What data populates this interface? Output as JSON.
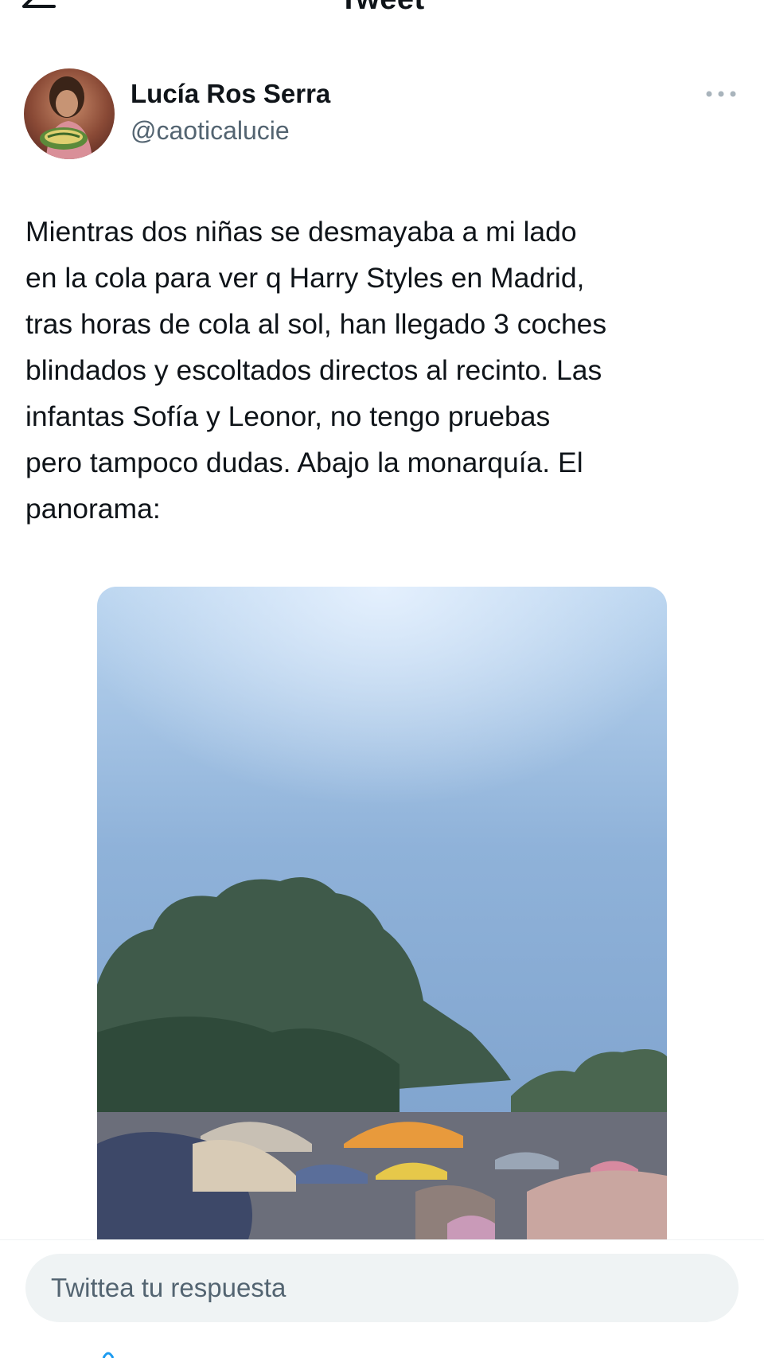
{
  "header": {
    "title": "Tweet",
    "back_icon": "arrow-left-icon"
  },
  "author": {
    "display_name": "Lucía Ros Serra",
    "handle": "@caoticalucie",
    "more_icon": "more-horizontal-icon"
  },
  "tweet": {
    "text": "Mientras dos niñas se desmayaba a mi lado\nen la cola para ver q Harry Styles en Madrid,\ntras horas de cola al sol, han llegado 3 coches\nblindados y escoltados directos al recinto. Las\ninfantas Sofía y Leonor, no tengo pruebas\npero tampoco dudas. Abajo la monarquía. El\npanorama:"
  },
  "reply": {
    "placeholder": "Twittea tu respuesta"
  },
  "colors": {
    "text_primary": "#0f1419",
    "text_secondary": "#536471",
    "input_bg": "#eff3f4",
    "accent": "#1d9bf0"
  }
}
